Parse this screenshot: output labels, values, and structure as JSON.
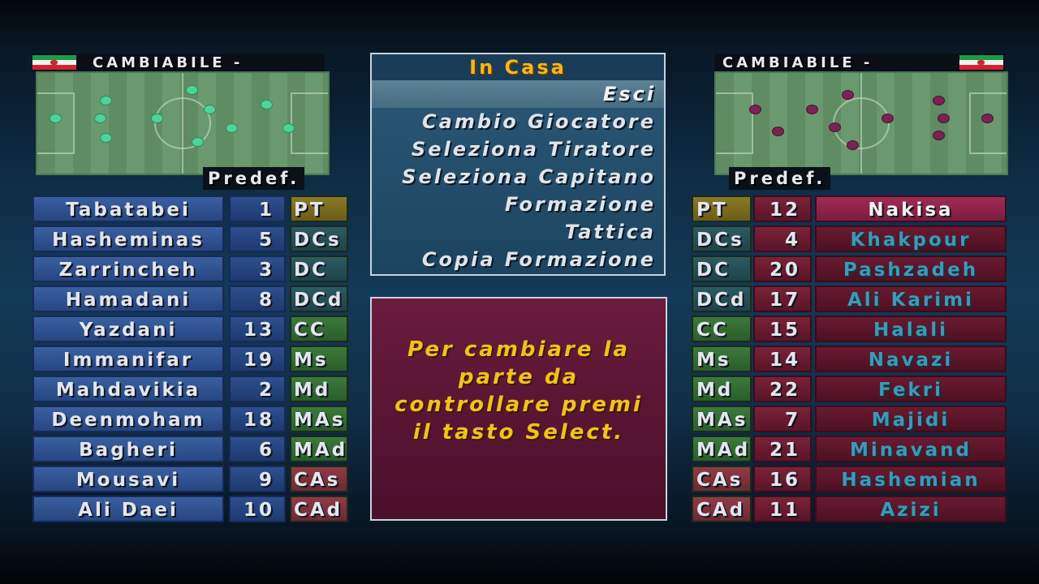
{
  "home": {
    "header_label": "CAMBIABILE -",
    "formation_label": "Predef.",
    "colors": {
      "name_bg": "#2d4f8c",
      "dot": "#4fd39a"
    },
    "players": [
      {
        "name": "Tabatabei",
        "number": "1",
        "position": "PT",
        "role": "gk"
      },
      {
        "name": "Hasheminas",
        "number": "5",
        "position": "DCs",
        "role": "df"
      },
      {
        "name": "Zarrincheh",
        "number": "3",
        "position": "DC",
        "role": "df"
      },
      {
        "name": "Hamadani",
        "number": "8",
        "position": "DCd",
        "role": "df"
      },
      {
        "name": "Yazdani",
        "number": "13",
        "position": "CC",
        "role": "mf"
      },
      {
        "name": "Immanifar",
        "number": "19",
        "position": "Ms",
        "role": "mf"
      },
      {
        "name": "Mahdavikia",
        "number": "2",
        "position": "Md",
        "role": "mf"
      },
      {
        "name": "Deenmoham",
        "number": "18",
        "position": "MAs",
        "role": "mf"
      },
      {
        "name": "Bagheri",
        "number": "6",
        "position": "MAd",
        "role": "mf"
      },
      {
        "name": "Mousavi",
        "number": "9",
        "position": "CAs",
        "role": "fw"
      },
      {
        "name": "Ali Daei",
        "number": "10",
        "position": "CAd",
        "role": "fw"
      }
    ]
  },
  "away": {
    "header_label": "CAMBIABILE -",
    "formation_label": "Predef.",
    "colors": {
      "name_bg": "#5a1428",
      "dot": "#7a2450",
      "dim_text": "#3a9ab8"
    },
    "players": [
      {
        "name": "Nakisa",
        "number": "12",
        "position": "PT",
        "role": "gk"
      },
      {
        "name": "Khakpour",
        "number": "4",
        "position": "DCs",
        "role": "df"
      },
      {
        "name": "Pashzadeh",
        "number": "20",
        "position": "DC",
        "role": "df"
      },
      {
        "name": "Ali Karimi",
        "number": "17",
        "position": "DCd",
        "role": "df"
      },
      {
        "name": "Halali",
        "number": "15",
        "position": "CC",
        "role": "mf"
      },
      {
        "name": "Navazi",
        "number": "14",
        "position": "Ms",
        "role": "mf"
      },
      {
        "name": "Fekri",
        "number": "22",
        "position": "Md",
        "role": "mf"
      },
      {
        "name": "Majidi",
        "number": "7",
        "position": "MAs",
        "role": "mf"
      },
      {
        "name": "Minavand",
        "number": "21",
        "position": "MAd",
        "role": "mf"
      },
      {
        "name": "Hashemian",
        "number": "16",
        "position": "CAs",
        "role": "fw"
      },
      {
        "name": "Azizi",
        "number": "11",
        "position": "CAd",
        "role": "fw"
      }
    ]
  },
  "menu": {
    "title": "In Casa",
    "items": [
      {
        "label": "Esci",
        "selected": true
      },
      {
        "label": "Cambio Giocatore",
        "selected": false
      },
      {
        "label": "Seleziona Tiratore",
        "selected": false
      },
      {
        "label": "Seleziona Capitano",
        "selected": false
      },
      {
        "label": "Formazione",
        "selected": false
      },
      {
        "label": "Tattica",
        "selected": false
      },
      {
        "label": "Copia Formazione",
        "selected": false
      }
    ]
  },
  "info": {
    "message": "Per cambiare la\nparte da\ncontrollare premi\nil tasto Select."
  }
}
